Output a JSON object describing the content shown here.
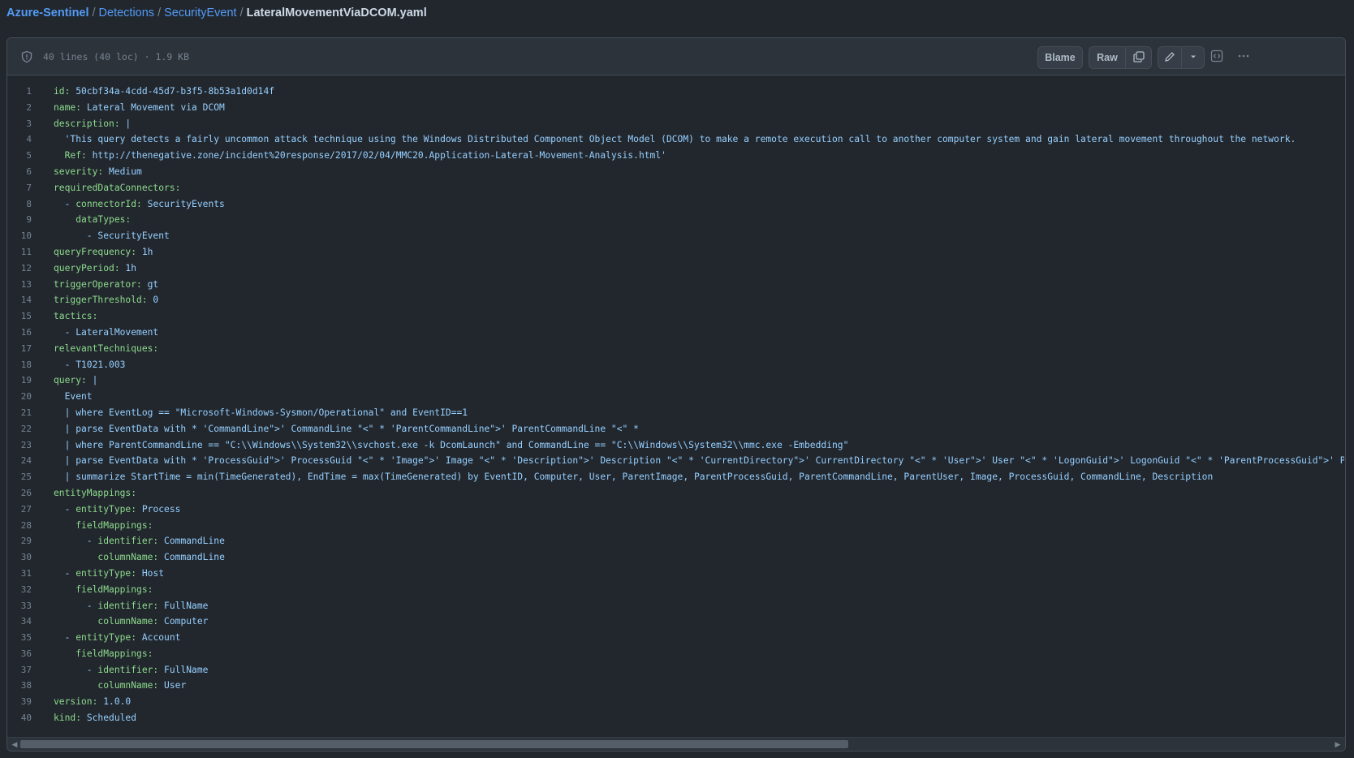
{
  "breadcrumb": {
    "repo": "Azure-Sentinel",
    "parts": [
      "Detections",
      "SecurityEvent"
    ],
    "file": "LateralMovementViaDCOM.yaml"
  },
  "file_info": "40 lines (40 loc) · 1.9 KB",
  "toolbar": {
    "blame": "Blame",
    "raw": "Raw",
    "icons": [
      "copy-icon",
      "pencil-icon",
      "chevron-down-icon",
      "code-square-icon",
      "kebab-icon"
    ]
  },
  "colors": {
    "key": "#8ddb8c",
    "value": "#96d0ff",
    "background": "#22272e",
    "link": "#539bf5"
  },
  "lines": [
    {
      "n": "1",
      "t": "id: 50cbf34a-4cdd-45d7-b3f5-8b53a1d0d14f"
    },
    {
      "n": "2",
      "t": "name: Lateral Movement via DCOM"
    },
    {
      "n": "3",
      "t": "description: |"
    },
    {
      "n": "4",
      "t": "  'This query detects a fairly uncommon attack technique using the Windows Distributed Component Object Model (DCOM) to make a remote execution call to another computer system and gain lateral movement throughout the network."
    },
    {
      "n": "5",
      "t": "  Ref: http://thenegative.zone/incident%20response/2017/02/04/MMC20.Application-Lateral-Movement-Analysis.html'"
    },
    {
      "n": "6",
      "t": "severity: Medium"
    },
    {
      "n": "7",
      "t": "requiredDataConnectors:"
    },
    {
      "n": "8",
      "t": "  - connectorId: SecurityEvents"
    },
    {
      "n": "9",
      "t": "    dataTypes:"
    },
    {
      "n": "10",
      "t": "      - SecurityEvent"
    },
    {
      "n": "11",
      "t": "queryFrequency: 1h"
    },
    {
      "n": "12",
      "t": "queryPeriod: 1h"
    },
    {
      "n": "13",
      "t": "triggerOperator: gt"
    },
    {
      "n": "14",
      "t": "triggerThreshold: 0"
    },
    {
      "n": "15",
      "t": "tactics:"
    },
    {
      "n": "16",
      "t": "  - LateralMovement"
    },
    {
      "n": "17",
      "t": "relevantTechniques:"
    },
    {
      "n": "18",
      "t": "  - T1021.003"
    },
    {
      "n": "19",
      "t": "query: |"
    },
    {
      "n": "20",
      "t": "  Event"
    },
    {
      "n": "21",
      "t": "  | where EventLog == \"Microsoft-Windows-Sysmon/Operational\" and EventID==1"
    },
    {
      "n": "22",
      "t": "  | parse EventData with * 'CommandLine\">' CommandLine \"<\" * 'ParentCommandLine\">' ParentCommandLine \"<\" *"
    },
    {
      "n": "23",
      "t": "  | where ParentCommandLine == \"C:\\\\Windows\\\\System32\\\\svchost.exe -k DcomLaunch\" and CommandLine == \"C:\\\\Windows\\\\System32\\\\mmc.exe -Embedding\""
    },
    {
      "n": "24",
      "t": "  | parse EventData with * 'ProcessGuid\">' ProcessGuid \"<\" * 'Image\">' Image \"<\" * 'Description\">' Description \"<\" * 'CurrentDirectory\">' CurrentDirectory \"<\" * 'User\">' User \"<\" * 'LogonGuid\">' LogonGuid \"<\" * 'ParentProcessGuid\">' ParentPr"
    },
    {
      "n": "25",
      "t": "  | summarize StartTime = min(TimeGenerated), EndTime = max(TimeGenerated) by EventID, Computer, User, ParentImage, ParentProcessGuid, ParentCommandLine, ParentUser, Image, ProcessGuid, CommandLine, Description"
    },
    {
      "n": "26",
      "t": "entityMappings:"
    },
    {
      "n": "27",
      "t": "  - entityType: Process"
    },
    {
      "n": "28",
      "t": "    fieldMappings:"
    },
    {
      "n": "29",
      "t": "      - identifier: CommandLine"
    },
    {
      "n": "30",
      "t": "        columnName: CommandLine"
    },
    {
      "n": "31",
      "t": "  - entityType: Host"
    },
    {
      "n": "32",
      "t": "    fieldMappings:"
    },
    {
      "n": "33",
      "t": "      - identifier: FullName"
    },
    {
      "n": "34",
      "t": "        columnName: Computer"
    },
    {
      "n": "35",
      "t": "  - entityType: Account"
    },
    {
      "n": "36",
      "t": "    fieldMappings:"
    },
    {
      "n": "37",
      "t": "      - identifier: FullName"
    },
    {
      "n": "38",
      "t": "        columnName: User"
    },
    {
      "n": "39",
      "t": "version: 1.0.0"
    },
    {
      "n": "40",
      "t": "kind: Scheduled"
    }
  ]
}
